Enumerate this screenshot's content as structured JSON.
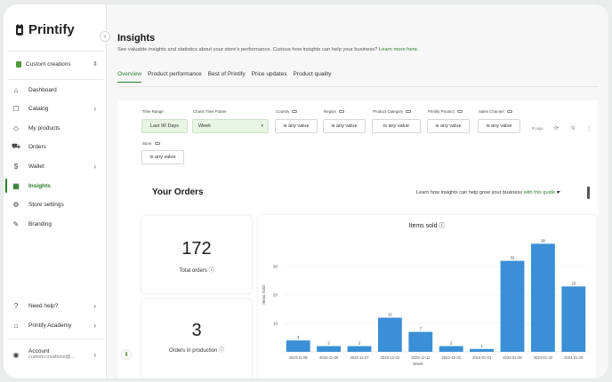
{
  "brand": {
    "name": "Printify"
  },
  "store": {
    "name": "Custom creations"
  },
  "sidebar": {
    "items": [
      {
        "label": "Dashboard",
        "icon": "home-icon"
      },
      {
        "label": "Catalog",
        "icon": "catalog-icon"
      },
      {
        "label": "My products",
        "icon": "tag-icon"
      },
      {
        "label": "Orders",
        "icon": "truck-icon"
      },
      {
        "label": "Wallet",
        "icon": "dollar-icon"
      },
      {
        "label": "Insights",
        "icon": "insights-icon"
      },
      {
        "label": "Store settings",
        "icon": "gear-icon"
      },
      {
        "label": "Branding",
        "icon": "branding-icon"
      }
    ],
    "bottom": [
      {
        "label": "Need help?"
      },
      {
        "label": "Printify Academy"
      }
    ],
    "account": {
      "label": "Account",
      "email": "custom.creations@..."
    }
  },
  "page": {
    "title": "Insights",
    "subtitle": "See valuable insights and statistics about your store's performance. Curious how insights can help your business?",
    "subtitle_link": "Learn more here.",
    "tabs": [
      "Overview",
      "Product performance",
      "Best of Printify",
      "Price updates",
      "Product quality"
    ]
  },
  "filters": {
    "time_range": {
      "label": "Time Range",
      "value": "Last 90 Days"
    },
    "charts_time_frame": {
      "label": "Charts Time Frame",
      "value": "Week"
    },
    "country": {
      "label": "Country",
      "value": "is any value"
    },
    "region": {
      "label": "Region",
      "value": "is any value"
    },
    "product_category": {
      "label": "Product Category",
      "value": "is any value"
    },
    "printify_product": {
      "label": "Printify Product",
      "value": "is any value"
    },
    "sales_channel": {
      "label": "Sales Channel",
      "value": "is any value"
    },
    "store": {
      "label": "Store",
      "value": "is any value"
    },
    "timezone": "th ago"
  },
  "section": {
    "title": "Your Orders",
    "learn_text": "Learn how insights can help grow your business",
    "learn_link": "with this guide"
  },
  "kpis": {
    "total_orders": {
      "value": "172",
      "label": "Total orders"
    },
    "orders_in_production": {
      "value": "3",
      "label": "Orders in production"
    }
  },
  "chart_data": {
    "type": "bar",
    "title": "Items sold",
    "xlabel": "Week",
    "ylabel": "Items Sold",
    "categories": [
      "2023-11-06",
      "2023-11-20",
      "2023-11-27",
      "2023-12-04",
      "2023-12-11",
      "2023-12-25",
      "2024-01-01",
      "2024-01-08",
      "2024-01-22",
      "2024-01-29"
    ],
    "values": [
      4,
      2,
      2,
      12,
      7,
      2,
      1,
      32,
      38,
      23
    ],
    "yticks": [
      10,
      20,
      30
    ],
    "ylim": [
      0,
      40
    ],
    "color": "#3a8fd6",
    "grid": true
  }
}
